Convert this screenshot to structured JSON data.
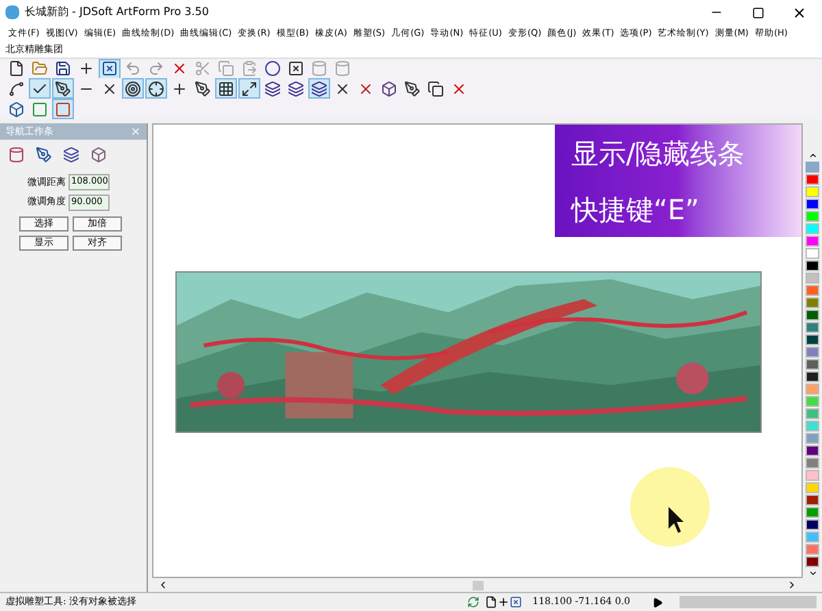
{
  "window": {
    "title": "长城新韵 - JDSoft ArtForm Pro 3.50"
  },
  "menu": [
    "文件(F)",
    "视图(V)",
    "编辑(E)",
    "曲线绘制(D)",
    "曲线编辑(C)",
    "变换(R)",
    "模型(B)",
    "橡皮(A)",
    "雕塑(S)",
    "几何(G)",
    "导动(N)",
    "特征(U)",
    "变形(Q)",
    "颜色(J)",
    "效果(T)",
    "选项(P)",
    "艺术绘制(Y)",
    "测量(M)",
    "帮助(H)"
  ],
  "company": "北京精雕集团",
  "nav_panel": {
    "title": "导航工作条",
    "fields": [
      {
        "label": "微调距离",
        "value": "108.000"
      },
      {
        "label": "微调角度",
        "value": "90.000"
      }
    ],
    "buttons": [
      "选择",
      "加倍",
      "显示",
      "对齐"
    ]
  },
  "banner": {
    "lines": [
      "显示/隐藏线条",
      "快捷键“E”"
    ]
  },
  "palette": [
    {
      "color": "#ff0000"
    },
    {
      "color": "#ffff00"
    },
    {
      "color": "#0000ff"
    },
    {
      "color": "#00ff00"
    },
    {
      "color": "#00ffff"
    },
    {
      "color": "#ff00ff"
    },
    {
      "color": "#ffffff"
    },
    {
      "color": "#000000"
    },
    {
      "color": "#c0c0c0"
    },
    {
      "color": "#ff6020"
    },
    {
      "color": "#808000"
    },
    {
      "color": "#006000"
    },
    {
      "color": "#308080"
    },
    {
      "color": "#004040"
    },
    {
      "color": "#8080c0"
    },
    {
      "color": "#606060"
    },
    {
      "color": "#202020"
    },
    {
      "color": "#ffa060"
    },
    {
      "color": "#40e040"
    },
    {
      "color": "#40c080"
    },
    {
      "color": "#40e0d0"
    },
    {
      "color": "#80a0c0"
    },
    {
      "color": "#600080"
    },
    {
      "color": "#808080"
    },
    {
      "color": "#ffc0cb"
    },
    {
      "color": "#ffd700"
    },
    {
      "color": "#a02000"
    },
    {
      "color": "#00a000"
    },
    {
      "color": "#000060"
    },
    {
      "color": "#40c0ff"
    },
    {
      "color": "#ff7060"
    },
    {
      "color": "#800000"
    }
  ],
  "status_bar": {
    "message": "虚拟雕塑工具: 没有对象被选择",
    "coordinates": "118.100 -71.164 0.0"
  }
}
